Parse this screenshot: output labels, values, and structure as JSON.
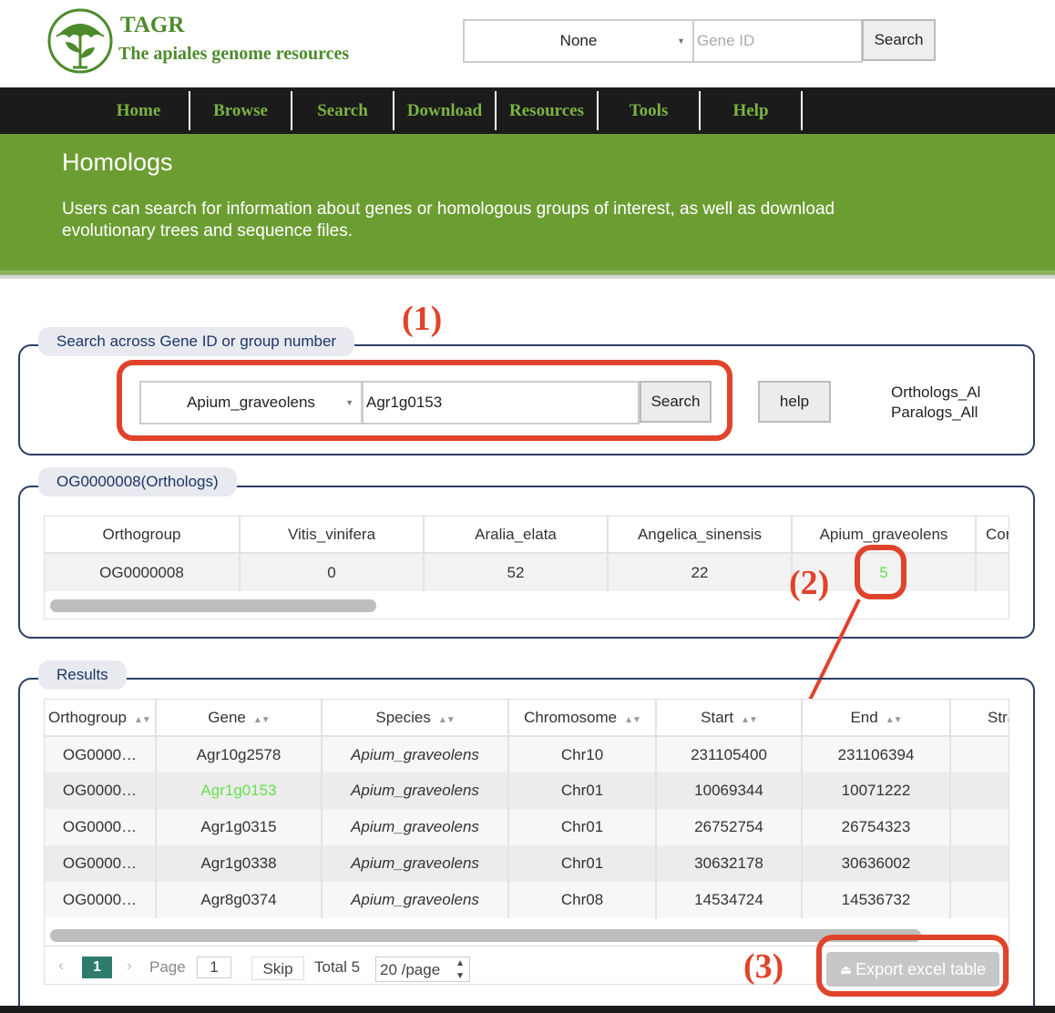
{
  "header": {
    "site_title": "TAGR",
    "site_subtitle": "The apiales genome resources",
    "species_select_value": "None",
    "gene_id_placeholder": "Gene ID",
    "search_label": "Search"
  },
  "nav": {
    "items": [
      "Home",
      "Browse",
      "Search",
      "Download",
      "Resources",
      "Tools",
      "Help"
    ]
  },
  "banner": {
    "title": "Homologs",
    "description": "Users can search for information about genes or homologous groups of interest, as well as download evolutionary trees and sequence files."
  },
  "search_panel": {
    "legend": "Search across Gene ID or group number",
    "species_value": "Apium_graveolens",
    "gene_value": "Agr1g0153",
    "search_label": "Search",
    "help_label": "help",
    "link_orthologs": "Orthologs_All",
    "link_paralogs": "Paralogs_All"
  },
  "orthogroup_panel": {
    "legend": "OG0000008(Orthologs)",
    "headers": [
      "Orthogroup",
      "Vitis_vinifera",
      "Aralia_elata",
      "Angelica_sinensis",
      "Apium_graveolens",
      "Coriandrum_sativum"
    ],
    "row": [
      "OG0000008",
      "0",
      "52",
      "22",
      "5",
      ""
    ]
  },
  "results_panel": {
    "legend": "Results",
    "headers": [
      "Orthogroup",
      "Gene",
      "Species",
      "Chromosome",
      "Start",
      "End",
      "Strand"
    ],
    "rows": [
      [
        "OG0000…",
        "Agr10g2578",
        "Apium_graveolens",
        "Chr10",
        "231105400",
        "231106394",
        ""
      ],
      [
        "OG0000…",
        "Agr1g0153",
        "Apium_graveolens",
        "Chr01",
        "10069344",
        "10071222",
        ""
      ],
      [
        "OG0000…",
        "Agr1g0315",
        "Apium_graveolens",
        "Chr01",
        "26752754",
        "26754323",
        ""
      ],
      [
        "OG0000…",
        "Agr1g0338",
        "Apium_graveolens",
        "Chr01",
        "30632178",
        "30636002",
        ""
      ],
      [
        "OG0000…",
        "Agr8g0374",
        "Apium_graveolens",
        "Chr08",
        "14534724",
        "14536732",
        ""
      ]
    ],
    "highlight_gene": "Agr1g0153"
  },
  "pager": {
    "prev": "‹",
    "current_page": "1",
    "next": "›",
    "page_label": "Page",
    "page_input": "1",
    "skip_label": "Skip",
    "total_label": "Total 5",
    "per_page": "20 /page",
    "export_label": "Export excel table"
  },
  "annotations": {
    "label_1": "(1)",
    "label_2": "(2)",
    "label_3": "(3)"
  },
  "colors": {
    "brand_green": "#6c9d33",
    "nav_text": "#7cb342",
    "highlight_red": "#e0432b",
    "link_green": "#66e050",
    "legend_text": "#1f3566"
  }
}
